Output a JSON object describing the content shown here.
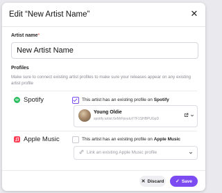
{
  "modal": {
    "title": "Edit “New Artist Name”",
    "close_glyph": "✕"
  },
  "artist_name": {
    "label": "Artist name",
    "required_marker": "*",
    "value": "New Artist Name"
  },
  "profiles": {
    "heading": "Profiles",
    "description": "Make sure to connect existing artist profiles to make sure your releases appear on any existing artist profile"
  },
  "spotify": {
    "service_name": "Spotify",
    "icon": "spotify-icon",
    "color": "#1db954",
    "checkbox_checked": true,
    "checkbox_text_prefix": "This artist has an existing profile on",
    "checkbox_text_service": "Spotify",
    "profile": {
      "name": "Young Oldie",
      "uri": "spotify:artist:6eMrFpvuIuY7F1SHBPUGpD"
    },
    "external_icon": "external-link-icon",
    "chevron": "chevron-down-icon"
  },
  "apple_music": {
    "service_name": "Apple Music",
    "icon": "apple-music-icon",
    "color": "#fa3c54",
    "checkbox_checked": false,
    "checkbox_text_prefix": "This artist has an existing profile on",
    "checkbox_text_service": "Apple Music",
    "link_placeholder": "Link an existing Apple Music profile",
    "link_icon": "link-icon",
    "chevron": "chevron-down-icon"
  },
  "footer": {
    "discard_label": "Discard",
    "save_label": "Save",
    "accent": "#7d4bf2"
  }
}
